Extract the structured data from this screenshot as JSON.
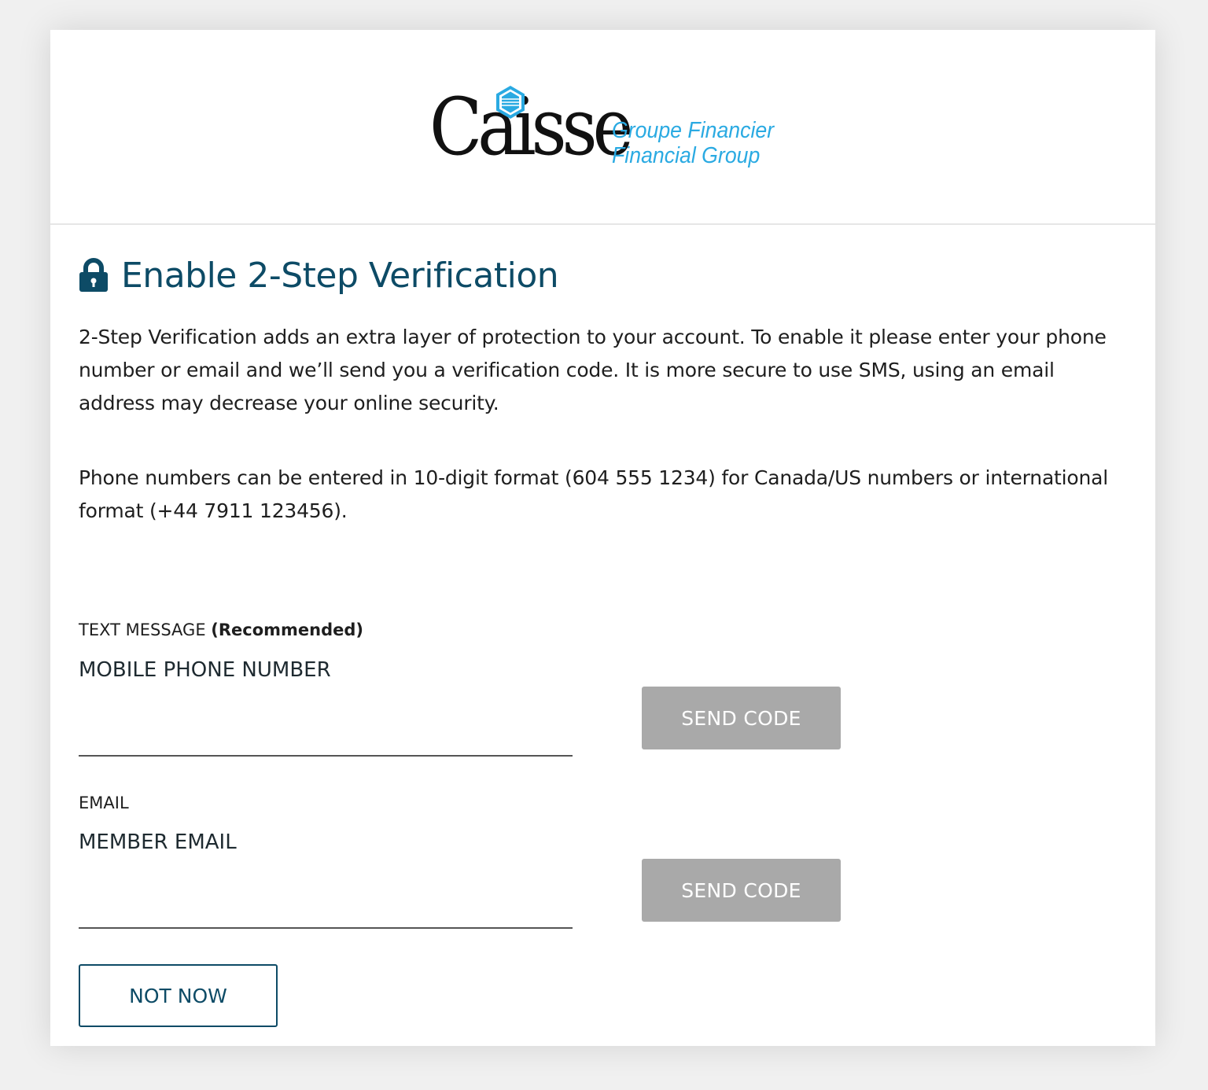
{
  "brand": {
    "name": "Caisse",
    "tagline_fr": "Groupe Financier",
    "tagline_en": "Financial Group",
    "accent_color": "#2aaae2",
    "primary_color": "#0d4b66"
  },
  "page": {
    "title": "Enable 2-Step Verification",
    "title_icon": "lock-icon",
    "intro": "2-Step Verification adds an extra layer of protection to your account. To enable it please enter your phone number or email and we’ll send you a verification code. It is more secure to use SMS, using an email address may decrease your online security.",
    "phone_format_note": "Phone numbers can be entered in 10-digit format (604 555 1234) for Canada/US numbers or international format (+44 7911 123456)."
  },
  "sms": {
    "section_label": "TEXT MESSAGE",
    "section_note": "(Recommended)",
    "field_label": "MOBILE PHONE NUMBER",
    "value": "",
    "button_label": "SEND CODE"
  },
  "email": {
    "section_label": "EMAIL",
    "field_label": "MEMBER EMAIL",
    "value": "",
    "button_label": "SEND CODE"
  },
  "actions": {
    "not_now_label": "NOT NOW"
  }
}
